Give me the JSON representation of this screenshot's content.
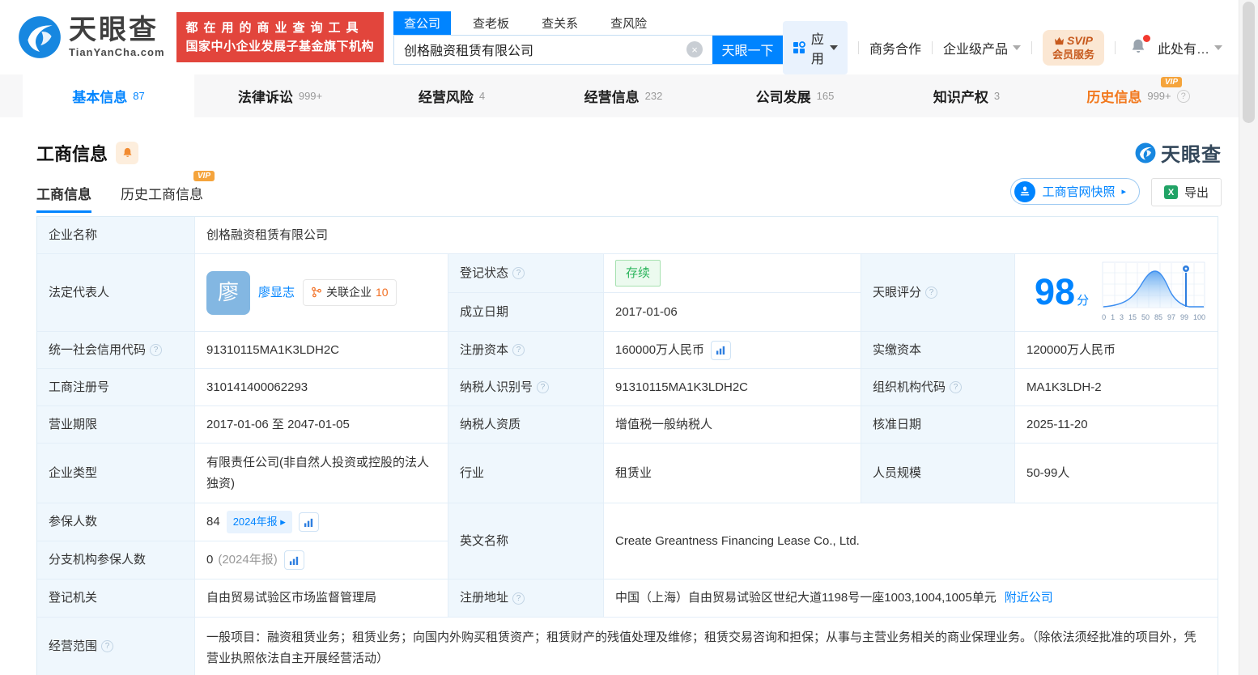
{
  "icons": {
    "help": "?",
    "close": "×",
    "arrow_right": "▸",
    "excel_x": "X",
    "vip": "VIP"
  },
  "brand": {
    "name": "天眼查",
    "domain": "TianYanCha.com",
    "slogan_line1": "都在用的商业查询工具",
    "slogan_line2": "国家中小企业发展子基金旗下机构"
  },
  "search": {
    "tabs": [
      {
        "label": "查公司"
      },
      {
        "label": "查老板"
      },
      {
        "label": "查关系"
      },
      {
        "label": "查风险"
      }
    ],
    "value": "创格融资租赁有限公司",
    "button": "天眼一下"
  },
  "top_nav": {
    "apps": "应用",
    "cooperation": "商务合作",
    "enterprise": "企业级产品",
    "svip_line1": "SVIP",
    "svip_line2": "会员服务",
    "more": "此处有…"
  },
  "tabs": [
    {
      "label": "基本信息",
      "count": "87"
    },
    {
      "label": "法律诉讼",
      "count": "999+"
    },
    {
      "label": "经营风险",
      "count": "4"
    },
    {
      "label": "经营信息",
      "count": "232"
    },
    {
      "label": "公司发展",
      "count": "165"
    },
    {
      "label": "知识产权",
      "count": "3"
    },
    {
      "label": "历史信息",
      "count": "999+"
    }
  ],
  "section": {
    "title": "工商信息",
    "subtabs": [
      {
        "label": "工商信息"
      },
      {
        "label": "历史工商信息"
      }
    ],
    "snapshot_button": "工商官网快照",
    "export_button": "导出",
    "watermark": "天眼查"
  },
  "company": {
    "name_label": "企业名称",
    "name": "创格融资租赁有限公司",
    "legal_rep_label": "法定代表人",
    "legal_rep_avatar": "廖",
    "legal_rep_name": "廖显志",
    "related_label": "关联企业",
    "related_count": "10",
    "reg_status_label": "登记状态",
    "reg_status": "存续",
    "establish_date_label": "成立日期",
    "establish_date": "2017-01-06",
    "score_label": "天眼评分",
    "score": "98",
    "score_unit": "分",
    "credit_code_label": "统一社会信用代码",
    "credit_code": "91310115MA1K3LDH2C",
    "reg_capital_label": "注册资本",
    "reg_capital": "160000万人民币",
    "paid_capital_label": "实缴资本",
    "paid_capital": "120000万人民币",
    "reg_number_label": "工商注册号",
    "reg_number": "310141400062293",
    "taxpayer_id_label": "纳税人识别号",
    "taxpayer_id": "91310115MA1K3LDH2C",
    "org_code_label": "组织机构代码",
    "org_code": "MA1K3LDH-2",
    "business_term_label": "营业期限",
    "business_term": "2017-01-06 至 2047-01-05",
    "taxpayer_quality_label": "纳税人资质",
    "taxpayer_quality": "增值税一般纳税人",
    "approval_date_label": "核准日期",
    "approval_date": "2025-11-20",
    "company_type_label": "企业类型",
    "company_type": "有限责任公司(非自然人投资或控股的法人独资)",
    "industry_label": "行业",
    "industry": "租赁业",
    "staff_size_label": "人员规模",
    "staff_size": "50-99人",
    "insured_label": "参保人数",
    "insured_count": "84",
    "insured_report": "2024年报",
    "branch_insured_label": "分支机构参保人数",
    "branch_insured_count": "0",
    "branch_insured_note": "(2024年报)",
    "english_name_label": "英文名称",
    "english_name": "Create Greantness Financing Lease Co., Ltd.",
    "reg_authority_label": "登记机关",
    "reg_authority": "自由贸易试验区市场监督管理局",
    "reg_address_label": "注册地址",
    "reg_address": "中国（上海）自由贸易试验区世纪大道1198号一座1003,1004,1005单元",
    "nearby_link": "附近公司",
    "business_scope_label": "经营范围",
    "business_scope": "一般项目：融资租赁业务；租赁业务；向国内外购买租赁资产；租赁财产的残值处理及维修；租赁交易咨询和担保；从事与主营业务相关的商业保理业务。（除依法须经批准的项目外，凭营业执照依法自主开展经营活动）"
  },
  "chart_data": {
    "type": "area",
    "title": "天眼评分分布曲线",
    "ticks": [
      "0",
      "1",
      "3",
      "15",
      "50",
      "85",
      "97",
      "99",
      "100"
    ],
    "score_marker": 98,
    "curve_peak_at": "50",
    "xlim": [
      0,
      100
    ]
  }
}
